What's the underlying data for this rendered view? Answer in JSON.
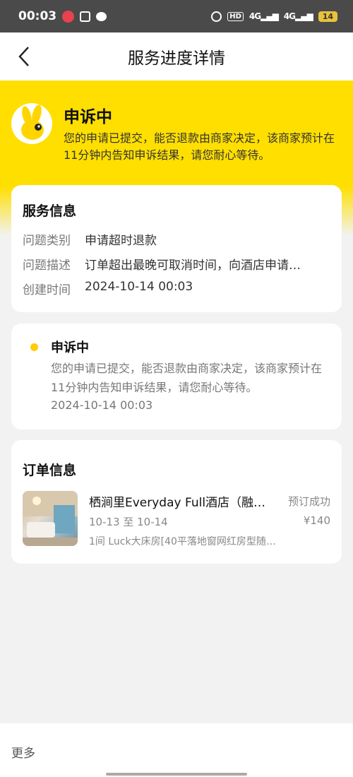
{
  "status_bar": {
    "time": "00:03",
    "battery": "14",
    "network_1": "4G",
    "network_2": "4G",
    "hd_tag": "HD"
  },
  "nav": {
    "title": "服务进度详情"
  },
  "hero": {
    "title": "申诉中",
    "description": "您的申请已提交，能否退款由商家决定，该商家预计在11分钟内告知申诉结果，请您耐心等待。"
  },
  "service_info": {
    "title": "服务信息",
    "rows": [
      {
        "label": "问题类别",
        "value": "申请超时退款"
      },
      {
        "label": "问题描述",
        "value": "订单超出最晚可取消时间，向酒店申请…"
      },
      {
        "label": "创建时间",
        "value": "2024-10-14 00:03"
      }
    ]
  },
  "progress": {
    "title": "申诉中",
    "description": "您的申请已提交，能否退款由商家决定，该商家预计在11分钟内告知申诉结果，请您耐心等待。",
    "time": "2024-10-14 00:03"
  },
  "order": {
    "title": "订单信息",
    "hotel_name": "栖涧里Everyday Full酒店（融…",
    "status": "预订成功",
    "dates": "10-13 至 10-14",
    "price": "¥140",
    "room": "1间 Luck大床房[40平落地窗网红房型随…"
  },
  "bottom": {
    "more_label": "更多"
  },
  "colors": {
    "brand_yellow": "#ffdf00",
    "dot_yellow": "#ffcc00"
  }
}
